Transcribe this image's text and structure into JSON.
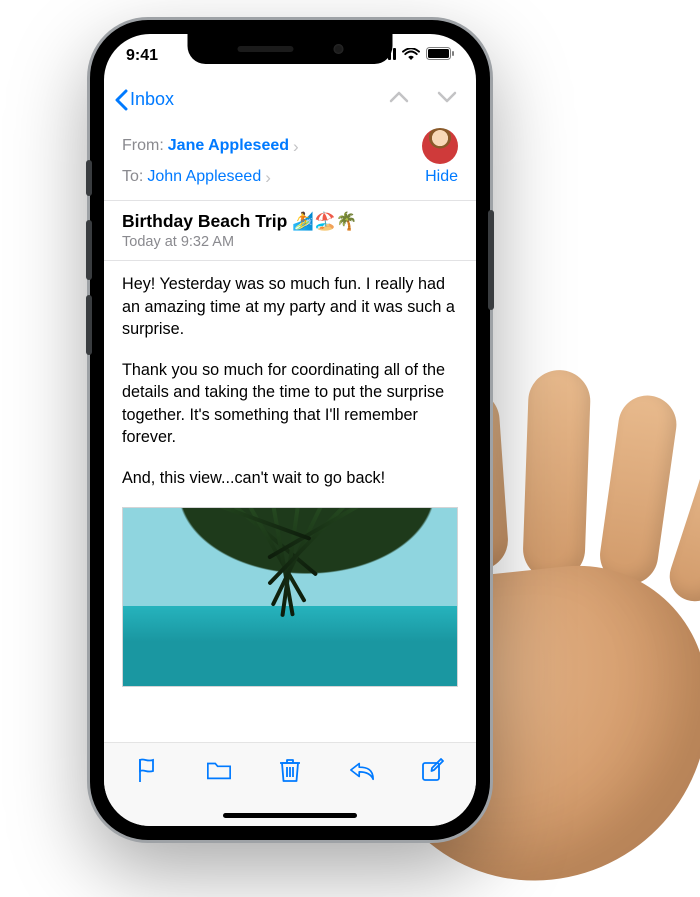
{
  "status": {
    "time": "9:41"
  },
  "nav": {
    "back_label": "Inbox"
  },
  "mail": {
    "from_label": "From:",
    "from_name": "Jane Appleseed",
    "to_label": "To:",
    "to_name": "John Appleseed",
    "hide_label": "Hide",
    "subject": "Birthday Beach Trip",
    "subject_emoji": "🏄🏖️🌴",
    "date": "Today at 9:32 AM",
    "paragraphs": [
      "Hey! Yesterday was so much fun. I really had an amazing time at my party and it was such a surprise.",
      "Thank you so much for coordinating all of the details and taking the time to put the surprise together. It's something that I'll remember forever.",
      "And, this view...can't wait to go back!"
    ]
  },
  "colors": {
    "tint": "#007aff"
  }
}
